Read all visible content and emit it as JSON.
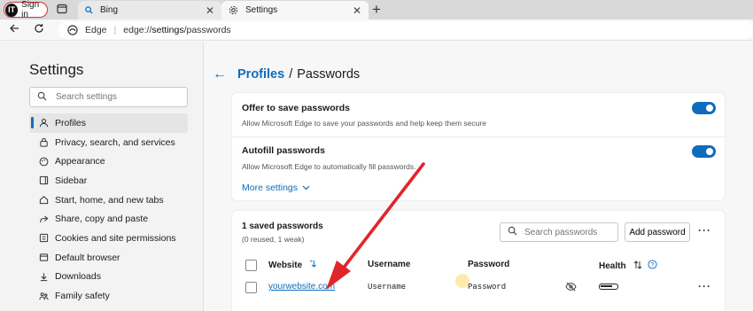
{
  "tabstrip": {
    "signin_label": "Sign in",
    "signin_logo": "IT",
    "tabs": [
      {
        "title": "Bing",
        "icon": "search-icon"
      },
      {
        "title": "Settings",
        "icon": "gear-icon"
      }
    ],
    "close_glyph": "✕",
    "newtab_glyph": "+"
  },
  "addressbar": {
    "brand": "Edge",
    "url_prefix": "edge://",
    "url_main": "settings",
    "url_suffix": "/passwords"
  },
  "sidebar": {
    "title": "Settings",
    "search_placeholder": "Search settings",
    "items": [
      {
        "label": "Profiles",
        "icon": "profile-icon",
        "active": true
      },
      {
        "label": "Privacy, search, and services",
        "icon": "lock-icon"
      },
      {
        "label": "Appearance",
        "icon": "palette-icon"
      },
      {
        "label": "Sidebar",
        "icon": "sidebar-icon"
      },
      {
        "label": "Start, home, and new tabs",
        "icon": "home-icon"
      },
      {
        "label": "Share, copy and paste",
        "icon": "share-icon"
      },
      {
        "label": "Cookies and site permissions",
        "icon": "permissions-icon"
      },
      {
        "label": "Default browser",
        "icon": "browser-icon"
      },
      {
        "label": "Downloads",
        "icon": "download-icon"
      },
      {
        "label": "Family safety",
        "icon": "family-icon"
      }
    ]
  },
  "breadcrumb": {
    "back_glyph": "←",
    "parent": "Profiles",
    "separator": "/",
    "current": "Passwords"
  },
  "settings_card": {
    "offer": {
      "title": "Offer to save passwords",
      "desc": "Allow Microsoft Edge to save your passwords and help keep them secure",
      "enabled": true
    },
    "autofill": {
      "title": "Autofill passwords",
      "desc": "Allow Microsoft Edge to automatically fill passwords.",
      "enabled": true
    },
    "more_settings": "More settings"
  },
  "saved_card": {
    "title": "1 saved passwords",
    "subtitle": "(0 reused, 1 weak)",
    "search_placeholder": "Search passwords",
    "add_button": "Add password",
    "more_glyph": "···",
    "columns": {
      "website": "Website",
      "username": "Username",
      "password": "Password",
      "health": "Health"
    },
    "rows": [
      {
        "website": "yourwebsite.com",
        "username": "Username",
        "password": "Password",
        "health_strength": 0.75
      }
    ]
  },
  "colors": {
    "accent": "#0f6cbd",
    "annotation_arrow": "#e0262b"
  }
}
